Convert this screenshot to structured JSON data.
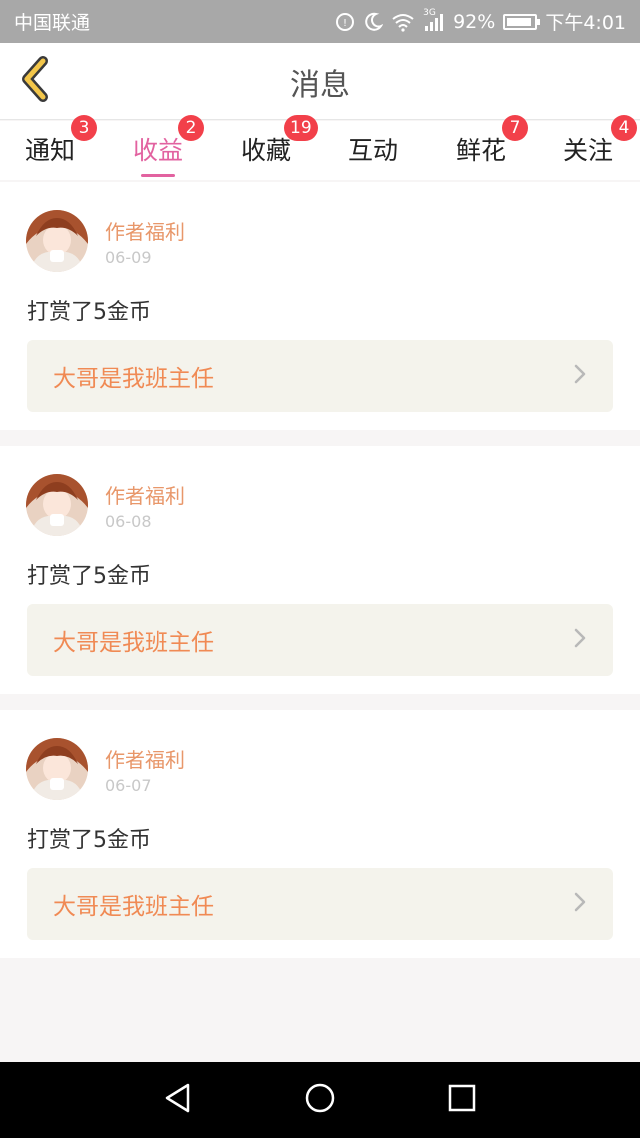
{
  "status_bar": {
    "carrier": "中国联通",
    "network": "3G",
    "battery": "92%",
    "battery_level": 0.92,
    "time": "下午4:01"
  },
  "header": {
    "title": "消息",
    "accent_color": "#f3c64a"
  },
  "tabs": [
    {
      "label": "通知",
      "badge": "3",
      "active": false
    },
    {
      "label": "收益",
      "badge": "2",
      "active": true
    },
    {
      "label": "收藏",
      "badge": "19",
      "active": false
    },
    {
      "label": "互动",
      "badge": "",
      "active": false
    },
    {
      "label": "鲜花",
      "badge": "7",
      "active": false
    },
    {
      "label": "关注",
      "badge": "4",
      "active": false
    }
  ],
  "messages": [
    {
      "author": "作者福利",
      "date": "06-09",
      "text": "打赏了5金币",
      "book_title": "大哥是我班主任"
    },
    {
      "author": "作者福利",
      "date": "06-08",
      "text": "打赏了5金币",
      "book_title": "大哥是我班主任"
    },
    {
      "author": "作者福利",
      "date": "06-07",
      "text": "打赏了5金币",
      "book_title": "大哥是我班主任"
    }
  ],
  "colors": {
    "active_tab": "#e262a0",
    "badge": "#f2404a",
    "author": "#e8976a",
    "book_title": "#f08a54"
  }
}
